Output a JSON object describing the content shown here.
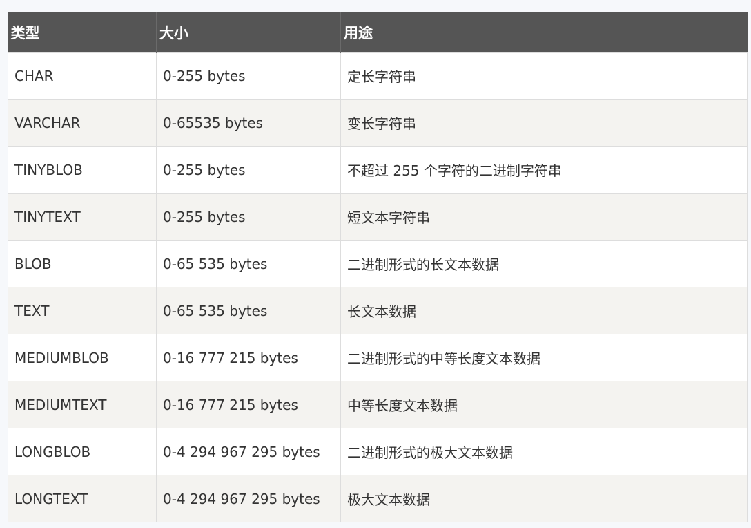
{
  "table": {
    "headers": [
      "类型",
      "大小",
      "用途"
    ],
    "rows": [
      [
        "CHAR",
        "0-255 bytes",
        "定长字符串"
      ],
      [
        "VARCHAR",
        "0-65535 bytes",
        "变长字符串"
      ],
      [
        "TINYBLOB",
        "0-255 bytes",
        "不超过 255 个字符的二进制字符串"
      ],
      [
        "TINYTEXT",
        "0-255 bytes",
        "短文本字符串"
      ],
      [
        "BLOB",
        "0-65 535 bytes",
        "二进制形式的长文本数据"
      ],
      [
        "TEXT",
        "0-65 535 bytes",
        "长文本数据"
      ],
      [
        "MEDIUMBLOB",
        "0-16 777 215 bytes",
        "二进制形式的中等长度文本数据"
      ],
      [
        "MEDIUMTEXT",
        "0-16 777 215 bytes",
        "中等长度文本数据"
      ],
      [
        "LONGBLOB",
        "0-4 294 967 295 bytes",
        "二进制形式的极大文本数据"
      ],
      [
        "LONGTEXT",
        "0-4 294 967 295 bytes",
        "极大文本数据"
      ]
    ]
  },
  "colors": {
    "header_bg": "#555555",
    "header_text": "#ffffff",
    "row_alt_bg": "#f4f3f0",
    "border": "#dddddd"
  }
}
